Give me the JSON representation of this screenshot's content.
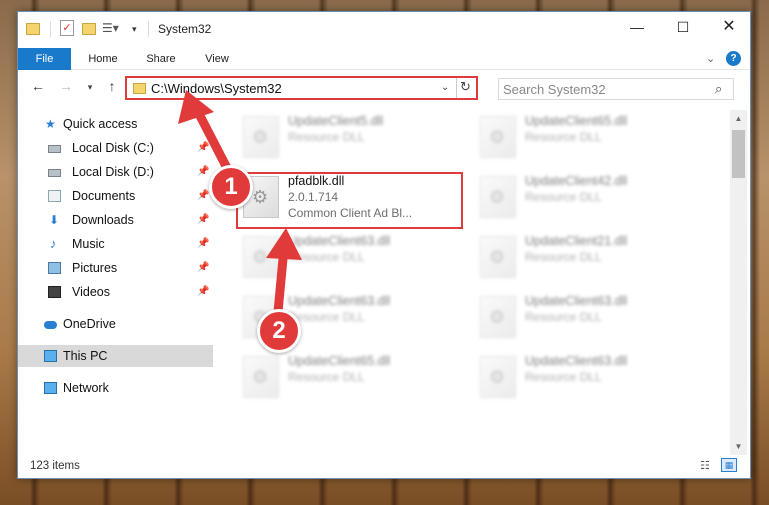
{
  "window": {
    "title": "System32",
    "controls": {
      "minimize": "—",
      "maximize": "☐",
      "close": "✕"
    }
  },
  "ribbon": {
    "tabs": [
      "File",
      "Home",
      "Share",
      "View"
    ]
  },
  "address": {
    "path": "C:\\Windows\\System32",
    "search_placeholder": "Search System32"
  },
  "nav": {
    "items": [
      {
        "label": "Quick access",
        "icon": "star-icon"
      },
      {
        "label": "Local Disk (C:)",
        "icon": "drive-icon",
        "pinned": true
      },
      {
        "label": "Local Disk (D:)",
        "icon": "drive-icon",
        "pinned": true
      },
      {
        "label": "Documents",
        "icon": "documents-icon",
        "pinned": true
      },
      {
        "label": "Downloads",
        "icon": "downloads-icon",
        "pinned": true
      },
      {
        "label": "Music",
        "icon": "music-icon",
        "pinned": true
      },
      {
        "label": "Pictures",
        "icon": "pictures-icon",
        "pinned": true
      },
      {
        "label": "Videos",
        "icon": "videos-icon",
        "pinned": true
      },
      {
        "label": "OneDrive",
        "icon": "onedrive-icon"
      },
      {
        "label": "This PC",
        "icon": "this-pc-icon",
        "selected": true
      },
      {
        "label": "Network",
        "icon": "network-icon"
      }
    ]
  },
  "files": [
    {
      "name": "UpdateClient5.dll",
      "type": "Resource DLL"
    },
    {
      "name": "UpdateClient65.dll",
      "type": "Resource DLL"
    },
    {
      "name": "pfadblk.dll",
      "type": "2.0.1.714",
      "desc": "Common Client Ad Bl..."
    },
    {
      "name": "UpdateClient42.dll",
      "type": "Resource DLL"
    },
    {
      "name": "UpdateClient63.dll",
      "type": "Resource DLL"
    },
    {
      "name": "UpdateClient21.dll",
      "type": "Resource DLL"
    },
    {
      "name": "UpdateClient63.dll",
      "type": "Resource DLL"
    },
    {
      "name": "UpdateClient63.dll",
      "type": "Resource DLL"
    },
    {
      "name": "UpdateClient65.dll",
      "type": "Resource DLL"
    },
    {
      "name": "UpdateClient63.dll",
      "type": "Resource DLL"
    }
  ],
  "status": {
    "item_count": "123 items"
  },
  "annotations": {
    "badge_1": "1",
    "badge_2": "2",
    "color": "#e13a3a"
  }
}
